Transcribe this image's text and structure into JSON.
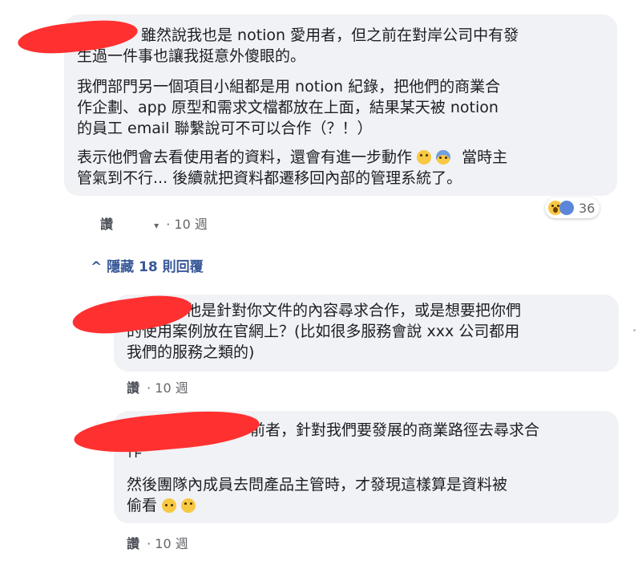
{
  "comment1": {
    "lines": [
      "雖然說我也是 notion 愛用者，但之前在對岸公司中有發",
      "生過一件事也讓我挺意外傻眼的。",
      "我們部門另一個項目小組都是用 notion 紀錄，把他們的商業合",
      "作企劃、app 原型和需求文檔都放在上面，結果某天被 notion",
      "的員工 email 聯繫說可不可以合作（？！）",
      "表示他們會去看使用者的資料，還會有進一步動作",
      "當時主",
      "管氣到不行... 後續就把資料都遷移回內部的管理系統了。"
    ],
    "reaction_count": "36",
    "read_label": "讚",
    "time": "· 10 週",
    "dropdown_glyph": "▾"
  },
  "replies_toggle": "^ 隱藏 18 則回覆",
  "reply1": {
    "lines": [
      "他是針對你文件的內容尋求合作，或是想要把你們",
      "的使用案例放在官網上？(比如很多服務會說 xxx 公司都用",
      "我們的服務之類的)"
    ],
    "read_label": "讚",
    "time": "· 10 週"
  },
  "reply2": {
    "lines": [
      "前者，針對我們要發展的商業路徑去尋求合",
      "作",
      "然後團隊內成員去問產品主管時，才發現這樣算是資料被",
      "偷看"
    ],
    "read_label": "讚",
    "time": "· 10 週"
  },
  "colors": {
    "bubble": "#f0f2f5",
    "redaction": "#ff3030",
    "link": "#385898"
  }
}
